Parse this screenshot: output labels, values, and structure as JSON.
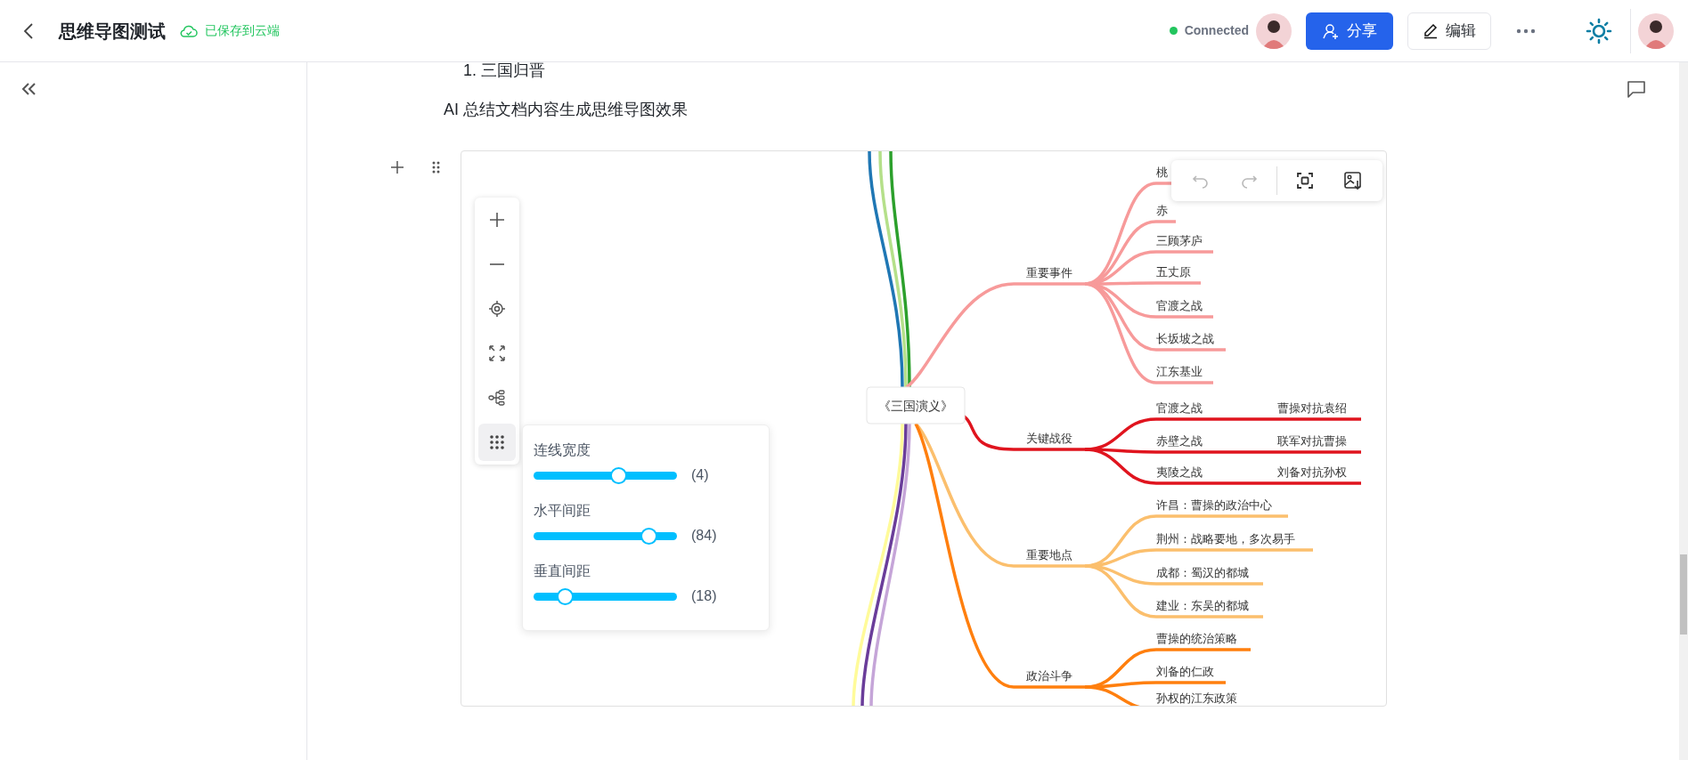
{
  "header": {
    "title": "思维导图测试",
    "save_status": "已保存到云端",
    "connection": {
      "text": "Connected",
      "online": true
    },
    "share_button": "分享",
    "edit_button": "编辑"
  },
  "document": {
    "list_item": {
      "number": "1.",
      "text": "三国归晋"
    },
    "paragraph": "AI 总结文档内容生成思维导图效果"
  },
  "mindmap": {
    "root": "《三国演义》",
    "upper_partial_branches": [
      {
        "color": "#1f77b4"
      },
      {
        "color": "#b5e08a"
      },
      {
        "color": "#2ca02c"
      }
    ],
    "lower_partial_branches": [
      {
        "color": "#fffb9a"
      },
      {
        "color": "#6a3d9a"
      },
      {
        "color": "#c5a5d8"
      }
    ],
    "branches": [
      {
        "label": "重要事件",
        "color": "#f79a9a",
        "children": [
          {
            "label": "桃"
          },
          {
            "label": "赤"
          },
          {
            "label": "三顾茅庐"
          },
          {
            "label": "五丈原"
          },
          {
            "label": "官渡之战"
          },
          {
            "label": "长坂坡之战"
          },
          {
            "label": "江东基业"
          }
        ]
      },
      {
        "label": "关键战役",
        "color": "#e0141e",
        "children": [
          {
            "label": "官渡之战",
            "children": [
              {
                "label": "曹操对抗袁绍"
              }
            ]
          },
          {
            "label": "赤壁之战",
            "children": [
              {
                "label": "联军对抗曹操"
              }
            ]
          },
          {
            "label": "夷陵之战",
            "children": [
              {
                "label": "刘备对抗孙权"
              }
            ]
          }
        ]
      },
      {
        "label": "重要地点",
        "color": "#fbbf6d",
        "children": [
          {
            "label": "许昌：曹操的政治中心"
          },
          {
            "label": "荆州：战略要地，多次易手"
          },
          {
            "label": "成都：蜀汉的都城"
          },
          {
            "label": "建业：东吴的都城"
          }
        ]
      },
      {
        "label": "政治斗争",
        "color": "#ff7f0e",
        "children": [
          {
            "label": "曹操的统治策略"
          },
          {
            "label": "刘备的仁政"
          },
          {
            "label": "孙权的江东政策"
          }
        ]
      }
    ],
    "tools": [
      {
        "kind": "zoom-in",
        "selected": false
      },
      {
        "kind": "zoom-out",
        "selected": false
      },
      {
        "kind": "locate",
        "selected": false
      },
      {
        "kind": "fit",
        "selected": false
      },
      {
        "kind": "layout",
        "selected": false
      },
      {
        "kind": "settings",
        "selected": true
      }
    ],
    "history_buttons": [
      {
        "kind": "undo",
        "disabled": true
      },
      {
        "kind": "redo",
        "disabled": true
      },
      {
        "kind": "fit-view",
        "disabled": false
      },
      {
        "kind": "export-image",
        "disabled": false
      }
    ],
    "sliders": [
      {
        "label": "连线宽度",
        "level": 0.59,
        "reading": "(4)"
      },
      {
        "label": "水平间距",
        "level": 0.8,
        "reading": "(84)"
      },
      {
        "label": "垂直间距",
        "level": 0.22,
        "reading": "(18)"
      }
    ]
  }
}
